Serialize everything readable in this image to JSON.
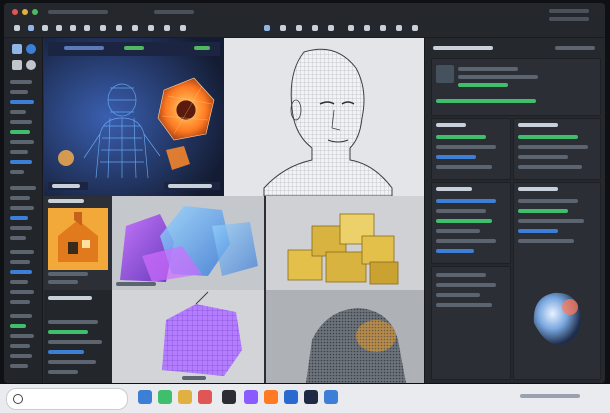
{
  "window": {
    "title": ""
  },
  "taskbar": {
    "search_placeholder": ""
  },
  "colors": {
    "hologram_blue": "#5aa0ff",
    "hologram_orange": "#ff8a2a",
    "purple": "#a05cff",
    "gold": "#d8b340",
    "panel_dark": "#25282d",
    "accent_green": "#3fbf6b",
    "accent_blue": "#3d7fd6"
  },
  "icons": {
    "search": "search-icon",
    "windows": "windows-start-icon"
  }
}
